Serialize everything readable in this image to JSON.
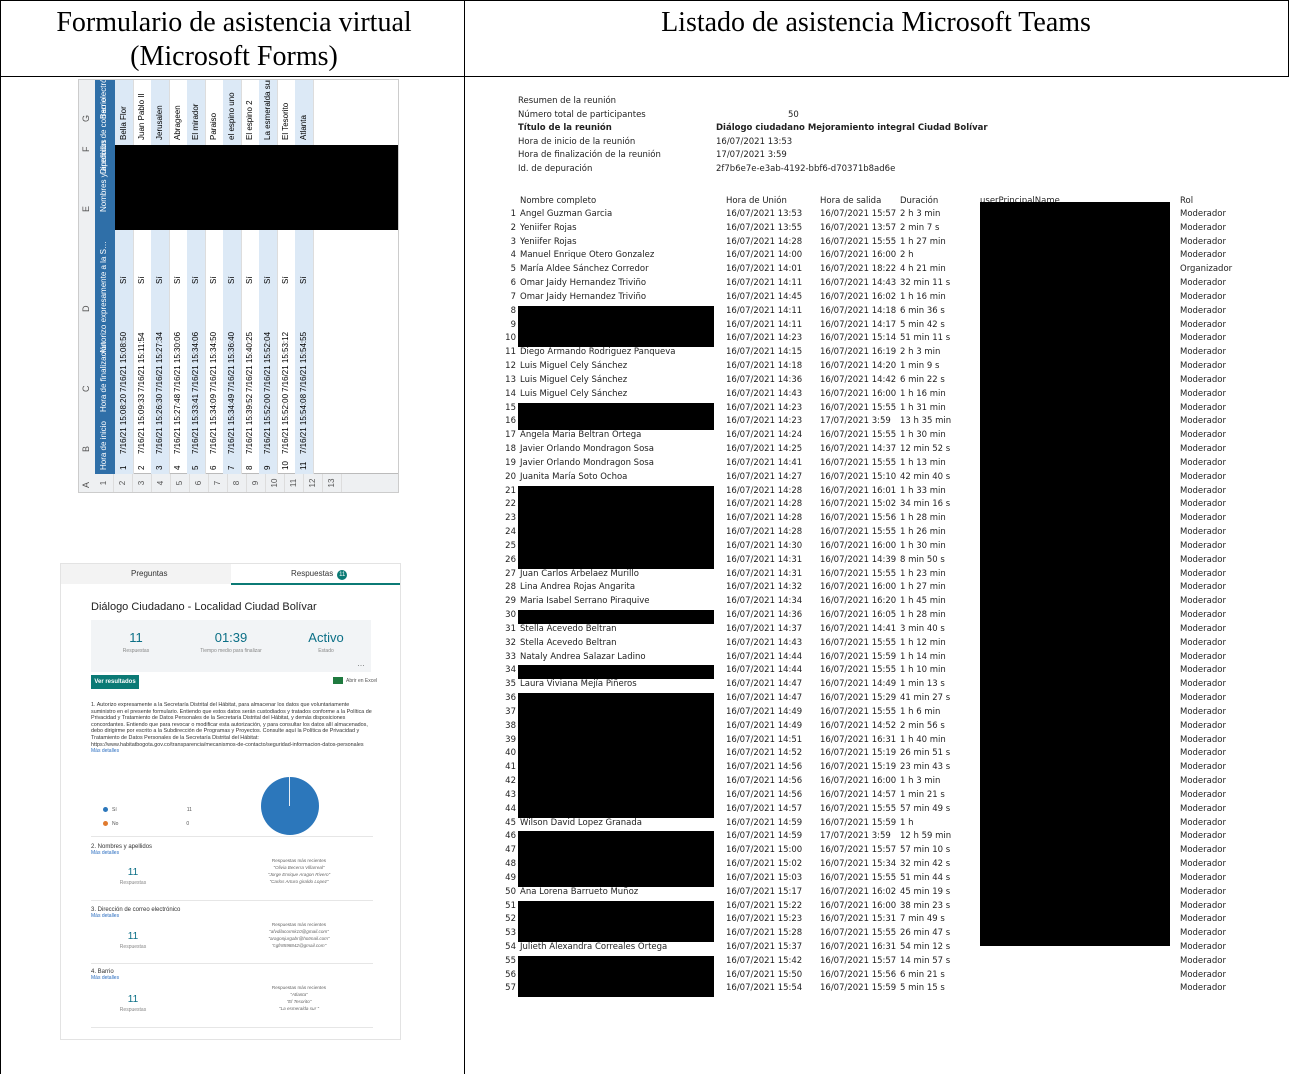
{
  "table": {
    "header_left": "Formulario de asistencia virtual (Microsoft Forms)",
    "header_right": "Listado de asistencia Microsoft Teams"
  },
  "spreadsheet": {
    "column_letters": [
      "A",
      "B",
      "C",
      "D",
      "E",
      "F",
      "G"
    ],
    "headers": [
      "Hora de inicio",
      "Hora de finalización",
      "Autorizo expresamente a la Secretaría Distrital del Hábitat, para almacenar los datos que voluntariamente suministro en el presente formulario. Entiendo que estos datos serán custodiados y tratados...",
      "Nombres y apellidos",
      "Dirección de correo electrónico",
      "Barrio"
    ],
    "rows": [
      {
        "n": "1",
        "inicio": "7/16/21 15:08:20",
        "fin": "7/16/21 15:08:50",
        "si": "Sí",
        "barrio": "Bella Flor"
      },
      {
        "n": "2",
        "inicio": "7/16/21 15:09:33",
        "fin": "7/16/21 15:11:54",
        "si": "Sí",
        "barrio": "Juan Pablo II"
      },
      {
        "n": "3",
        "inicio": "7/16/21 15:26:30",
        "fin": "7/16/21 15:27:34",
        "si": "Sí",
        "barrio": "Jerusalen"
      },
      {
        "n": "4",
        "inicio": "7/16/21 15:27:48",
        "fin": "7/16/21 15:30:06",
        "si": "Sí",
        "barrio": "Abrageen"
      },
      {
        "n": "5",
        "inicio": "7/16/21 15:33:41",
        "fin": "7/16/21 15:34:06",
        "si": "Sí",
        "barrio": "El mirador"
      },
      {
        "n": "6",
        "inicio": "7/16/21 15:34:09",
        "fin": "7/16/21 15:34:50",
        "si": "Sí",
        "barrio": "Paraiso"
      },
      {
        "n": "7",
        "inicio": "7/16/21 15:34:49",
        "fin": "7/16/21 15:36:40",
        "si": "Sí",
        "barrio": "el espino uno"
      },
      {
        "n": "8",
        "inicio": "7/16/21 15:39:52",
        "fin": "7/16/21 15:40:25",
        "si": "Sí",
        "barrio": "El espino 2"
      },
      {
        "n": "9",
        "inicio": "7/16/21 15:52:00",
        "fin": "7/16/21 15:52:04",
        "si": "Sí",
        "barrio": "La esmeralda sur"
      },
      {
        "n": "10",
        "inicio": "7/16/21 15:52:00",
        "fin": "7/16/21 15:53:12",
        "si": "Sí",
        "barrio": "El Tesorito"
      },
      {
        "n": "11",
        "inicio": "7/16/21 15:54:08",
        "fin": "7/16/21 15:54:55",
        "si": "Sí",
        "barrio": "Atlanta"
      }
    ]
  },
  "forms": {
    "tab_preguntas": "Preguntas",
    "tab_respuestas": "Respuestas",
    "tab_badge": "11",
    "title": "Diálogo Ciudadano - Localidad Ciudad Bolívar",
    "stats": [
      {
        "value": "11",
        "label": "Respuestas"
      },
      {
        "value": "01:39",
        "label": "Tiempo medio para finalizar"
      },
      {
        "value": "Activo",
        "label": "Estado"
      }
    ],
    "ver_resultados": "Ver resultados",
    "abrir_excel": "Abrir en Excel",
    "q1_text": "1. Autorizo expresamente a la Secretaría Distrital del Hábitat, para almacenar los datos que voluntariamente suministro en el presente formulario. Entiendo que estos datos serán custodiados y tratados conforme a la Política de Privacidad y Tratamiento de Datos Personales de la Secretaría Distrital del Hábitat, y demás disposiciones concordantes. Entiendo que para revocar o modificar esta autorización, y para consultar los datos allí almacenados, debo dirigirme por escrito a la Subdirección de Programas y Proyectos. Consulte aquí la Política de Privacidad y Tratamiento de Datos Personales de la Secretaría Distrital del Hábitat: https://www.habitatbogota.gov.co/transparencia/mecanismos-de-contacto/seguridad-informacion-datos-personales",
    "mas_detalles": "Más detalles",
    "legend": [
      {
        "label": "Sí",
        "count": "11",
        "color": "#2c77bb"
      },
      {
        "label": "No",
        "count": "0",
        "color": "#e07a2e"
      }
    ],
    "questions": [
      {
        "title": "2. Nombres y apellidos",
        "count": "11",
        "count_label": "Respuestas",
        "recent_label": "Respuestas más recientes",
        "recent": [
          "\"Olivia Becerra Villarreal\"",
          "\"Jorge Enrique Aragon Rivero\"",
          "\"Carlos Arturo giraldo Lopez\""
        ]
      },
      {
        "title": "3. Dirección de correo electrónico",
        "count": "11",
        "count_label": "Respuestas",
        "recent_label": "Respuestas más recientes",
        "recent": [
          "\"afvdilacormk10@gmail.com\"",
          "\"aragonjurgabr@hotmail.com\"",
          "\"cgfr8598842@gmail.com\""
        ]
      },
      {
        "title": "4. Barrio",
        "count": "11",
        "count_label": "Respuestas",
        "recent_label": "Respuestas más recientes",
        "recent": [
          "\"Atlanta\"",
          "\"El Tesorito\"",
          "\"La esmeralda sur \""
        ]
      }
    ]
  },
  "teams": {
    "summary": [
      {
        "label": "Resumen de la reunión",
        "value": ""
      },
      {
        "label": "Número total de participantes",
        "value": "50"
      },
      {
        "label": "Título de la reunión",
        "value": "Diálogo ciudadano Mejoramiento integral Ciudad Bolívar"
      },
      {
        "label": "Hora de inicio de la reunión",
        "value": "16/07/2021 13:53"
      },
      {
        "label": "Hora de finalización de la reunión",
        "value": "17/07/2021 3:59"
      },
      {
        "label": "Id. de depuración",
        "value": "2f7b6e7e-e3ab-4192-bbf6-d70371b8ad6e"
      }
    ],
    "columns": [
      "Nombre completo",
      "Hora de Unión",
      "Hora de salida",
      "Duración",
      "userPrincipalName",
      "Rol"
    ],
    "rows": [
      {
        "n": "1",
        "name": "Angel Guzman Garcia",
        "in": "16/07/2021 13:53",
        "out": "16/07/2021 15:57",
        "dur": "2 h 3 min",
        "rol": "Moderador"
      },
      {
        "n": "2",
        "name": "Yeniifer Rojas",
        "in": "16/07/2021 13:55",
        "out": "16/07/2021 13:57",
        "dur": "2 min 7 s",
        "rol": "Moderador"
      },
      {
        "n": "3",
        "name": "Yeniifer Rojas",
        "in": "16/07/2021 14:28",
        "out": "16/07/2021 15:55",
        "dur": "1 h 27 min",
        "rol": "Moderador"
      },
      {
        "n": "4",
        "name": "Manuel Enrique Otero Gonzalez",
        "in": "16/07/2021 14:00",
        "out": "16/07/2021 16:00",
        "dur": "2 h",
        "rol": "Moderador"
      },
      {
        "n": "5",
        "name": "María Aldee Sánchez Corredor",
        "in": "16/07/2021 14:01",
        "out": "16/07/2021 18:22",
        "dur": "4 h 21 min",
        "rol": "Organizador"
      },
      {
        "n": "6",
        "name": "Omar Jaidy Hernandez Triviño",
        "in": "16/07/2021 14:11",
        "out": "16/07/2021 14:43",
        "dur": "32 min 11 s",
        "rol": "Moderador"
      },
      {
        "n": "7",
        "name": "Omar Jaidy Hernandez Triviño",
        "in": "16/07/2021 14:45",
        "out": "16/07/2021 16:02",
        "dur": "1 h 16 min",
        "rol": "Moderador"
      },
      {
        "n": "8",
        "name": "",
        "in": "16/07/2021 14:11",
        "out": "16/07/2021 14:18",
        "dur": "6 min 36 s",
        "rol": "Moderador"
      },
      {
        "n": "9",
        "name": "",
        "in": "16/07/2021 14:11",
        "out": "16/07/2021 14:17",
        "dur": "5 min 42 s",
        "rol": "Moderador"
      },
      {
        "n": "10",
        "name": "",
        "in": "16/07/2021 14:23",
        "out": "16/07/2021 15:14",
        "dur": "51 min 11 s",
        "rol": "Moderador"
      },
      {
        "n": "11",
        "name": "Diego Armando Rodriguez Panqueva",
        "in": "16/07/2021 14:15",
        "out": "16/07/2021 16:19",
        "dur": "2 h 3 min",
        "rol": "Moderador"
      },
      {
        "n": "12",
        "name": "Luis Miguel Cely Sánchez",
        "in": "16/07/2021 14:18",
        "out": "16/07/2021 14:20",
        "dur": "1 min 9 s",
        "rol": "Moderador"
      },
      {
        "n": "13",
        "name": "Luis Miguel Cely Sánchez",
        "in": "16/07/2021 14:36",
        "out": "16/07/2021 14:42",
        "dur": "6 min 22 s",
        "rol": "Moderador"
      },
      {
        "n": "14",
        "name": "Luis Miguel Cely Sánchez",
        "in": "16/07/2021 14:43",
        "out": "16/07/2021 16:00",
        "dur": "1 h 16 min",
        "rol": "Moderador"
      },
      {
        "n": "15",
        "name": "",
        "in": "16/07/2021 14:23",
        "out": "16/07/2021 15:55",
        "dur": "1 h 31 min",
        "rol": "Moderador"
      },
      {
        "n": "16",
        "name": "",
        "in": "16/07/2021 14:23",
        "out": "17/07/2021 3:59",
        "dur": "13 h 35 min",
        "rol": "Moderador"
      },
      {
        "n": "17",
        "name": "Angela Maria Beltran Ortega",
        "in": "16/07/2021 14:24",
        "out": "16/07/2021 15:55",
        "dur": "1 h 30 min",
        "rol": "Moderador"
      },
      {
        "n": "18",
        "name": "Javier Orlando Mondragon Sosa",
        "in": "16/07/2021 14:25",
        "out": "16/07/2021 14:37",
        "dur": "12 min 52 s",
        "rol": "Moderador"
      },
      {
        "n": "19",
        "name": "Javier Orlando Mondragon Sosa",
        "in": "16/07/2021 14:41",
        "out": "16/07/2021 15:55",
        "dur": "1 h 13 min",
        "rol": "Moderador"
      },
      {
        "n": "20",
        "name": "Juanita María Soto Ochoa",
        "in": "16/07/2021 14:27",
        "out": "16/07/2021 15:10",
        "dur": "42 min 40 s",
        "rol": "Moderador"
      },
      {
        "n": "21",
        "name": "",
        "in": "16/07/2021 14:28",
        "out": "16/07/2021 16:01",
        "dur": "1 h 33 min",
        "rol": "Moderador"
      },
      {
        "n": "22",
        "name": "",
        "in": "16/07/2021 14:28",
        "out": "16/07/2021 15:02",
        "dur": "34 min 16 s",
        "rol": "Moderador"
      },
      {
        "n": "23",
        "name": "",
        "in": "16/07/2021 14:28",
        "out": "16/07/2021 15:56",
        "dur": "1 h 28 min",
        "rol": "Moderador"
      },
      {
        "n": "24",
        "name": "",
        "in": "16/07/2021 14:28",
        "out": "16/07/2021 15:55",
        "dur": "1 h 26 min",
        "rol": "Moderador"
      },
      {
        "n": "25",
        "name": "",
        "in": "16/07/2021 14:30",
        "out": "16/07/2021 16:00",
        "dur": "1 h 30 min",
        "rol": "Moderador"
      },
      {
        "n": "26",
        "name": "",
        "in": "16/07/2021 14:31",
        "out": "16/07/2021 14:39",
        "dur": "8 min 50 s",
        "rol": "Moderador"
      },
      {
        "n": "27",
        "name": "Juan Carlos Arbelaez Murillo",
        "in": "16/07/2021 14:31",
        "out": "16/07/2021 15:55",
        "dur": "1 h 23 min",
        "rol": "Moderador"
      },
      {
        "n": "28",
        "name": "Lina Andrea Rojas Angarita",
        "in": "16/07/2021 14:32",
        "out": "16/07/2021 16:00",
        "dur": "1 h 27 min",
        "rol": "Moderador"
      },
      {
        "n": "29",
        "name": "Maria Isabel Serrano Piraquive",
        "in": "16/07/2021 14:34",
        "out": "16/07/2021 16:20",
        "dur": "1 h 45 min",
        "rol": "Moderador"
      },
      {
        "n": "30",
        "name": "",
        "in": "16/07/2021 14:36",
        "out": "16/07/2021 16:05",
        "dur": "1 h 28 min",
        "rol": "Moderador"
      },
      {
        "n": "31",
        "name": "Stella Acevedo Beltran",
        "in": "16/07/2021 14:37",
        "out": "16/07/2021 14:41",
        "dur": "3 min 40 s",
        "rol": "Moderador"
      },
      {
        "n": "32",
        "name": "Stella Acevedo Beltran",
        "in": "16/07/2021 14:43",
        "out": "16/07/2021 15:55",
        "dur": "1 h 12 min",
        "rol": "Moderador"
      },
      {
        "n": "33",
        "name": "Nataly Andrea Salazar Ladino",
        "in": "16/07/2021 14:44",
        "out": "16/07/2021 15:59",
        "dur": "1 h 14 min",
        "rol": "Moderador"
      },
      {
        "n": "34",
        "name": "",
        "in": "16/07/2021 14:44",
        "out": "16/07/2021 15:55",
        "dur": "1 h 10 min",
        "rol": "Moderador"
      },
      {
        "n": "35",
        "name": "Laura Viviana Mejía Piñeros",
        "in": "16/07/2021 14:47",
        "out": "16/07/2021 14:49",
        "dur": "1 min 13 s",
        "rol": "Moderador"
      },
      {
        "n": "36",
        "name": "",
        "in": "16/07/2021 14:47",
        "out": "16/07/2021 15:29",
        "dur": "41 min 27 s",
        "rol": "Moderador"
      },
      {
        "n": "37",
        "name": "",
        "in": "16/07/2021 14:49",
        "out": "16/07/2021 15:55",
        "dur": "1 h 6 min",
        "rol": "Moderador"
      },
      {
        "n": "38",
        "name": "",
        "in": "16/07/2021 14:49",
        "out": "16/07/2021 14:52",
        "dur": "2 min 56 s",
        "rol": "Moderador"
      },
      {
        "n": "39",
        "name": "",
        "in": "16/07/2021 14:51",
        "out": "16/07/2021 16:31",
        "dur": "1 h 40 min",
        "rol": "Moderador"
      },
      {
        "n": "40",
        "name": "",
        "in": "16/07/2021 14:52",
        "out": "16/07/2021 15:19",
        "dur": "26 min 51 s",
        "rol": "Moderador"
      },
      {
        "n": "41",
        "name": "",
        "in": "16/07/2021 14:56",
        "out": "16/07/2021 15:19",
        "dur": "23 min 43 s",
        "rol": "Moderador"
      },
      {
        "n": "42",
        "name": "",
        "in": "16/07/2021 14:56",
        "out": "16/07/2021 16:00",
        "dur": "1 h 3 min",
        "rol": "Moderador"
      },
      {
        "n": "43",
        "name": "",
        "in": "16/07/2021 14:56",
        "out": "16/07/2021 14:57",
        "dur": "1 min 21 s",
        "rol": "Moderador"
      },
      {
        "n": "44",
        "name": "",
        "in": "16/07/2021 14:57",
        "out": "16/07/2021 15:55",
        "dur": "57 min 49 s",
        "rol": "Moderador"
      },
      {
        "n": "45",
        "name": "Wilson David Lopez Granada",
        "in": "16/07/2021 14:59",
        "out": "16/07/2021 15:59",
        "dur": "1 h",
        "rol": "Moderador"
      },
      {
        "n": "46",
        "name": "",
        "in": "16/07/2021 14:59",
        "out": "17/07/2021 3:59",
        "dur": "12 h 59 min",
        "rol": "Moderador"
      },
      {
        "n": "47",
        "name": "",
        "in": "16/07/2021 15:00",
        "out": "16/07/2021 15:57",
        "dur": "57 min 10 s",
        "rol": "Moderador"
      },
      {
        "n": "48",
        "name": "",
        "in": "16/07/2021 15:02",
        "out": "16/07/2021 15:34",
        "dur": "32 min 42 s",
        "rol": "Moderador"
      },
      {
        "n": "49",
        "name": "",
        "in": "16/07/2021 15:03",
        "out": "16/07/2021 15:55",
        "dur": "51 min 44 s",
        "rol": "Moderador"
      },
      {
        "n": "50",
        "name": "Ana Lorena Barrueto Muñoz",
        "in": "16/07/2021 15:17",
        "out": "16/07/2021 16:02",
        "dur": "45 min 19 s",
        "rol": "Moderador"
      },
      {
        "n": "51",
        "name": "",
        "in": "16/07/2021 15:22",
        "out": "16/07/2021 16:00",
        "dur": "38 min 23 s",
        "rol": "Moderador"
      },
      {
        "n": "52",
        "name": "",
        "in": "16/07/2021 15:23",
        "out": "16/07/2021 15:31",
        "dur": "7 min 49 s",
        "rol": "Moderador"
      },
      {
        "n": "53",
        "name": "",
        "in": "16/07/2021 15:28",
        "out": "16/07/2021 15:55",
        "dur": "26 min 47 s",
        "rol": "Moderador"
      },
      {
        "n": "54",
        "name": "Julieth Alexandra Correales Ortega",
        "in": "16/07/2021 15:37",
        "out": "16/07/2021 16:31",
        "dur": "54 min 12 s",
        "rol": "Moderador"
      },
      {
        "n": "55",
        "name": "",
        "in": "16/07/2021 15:42",
        "out": "16/07/2021 15:57",
        "dur": "14 min 57 s",
        "rol": "Moderador"
      },
      {
        "n": "56",
        "name": "",
        "in": "16/07/2021 15:50",
        "out": "16/07/2021 15:56",
        "dur": "6 min 21 s",
        "rol": "Moderador"
      },
      {
        "n": "57",
        "name": "",
        "in": "16/07/2021 15:54",
        "out": "16/07/2021 15:59",
        "dur": "5 min 15 s",
        "rol": "Moderador"
      }
    ]
  }
}
